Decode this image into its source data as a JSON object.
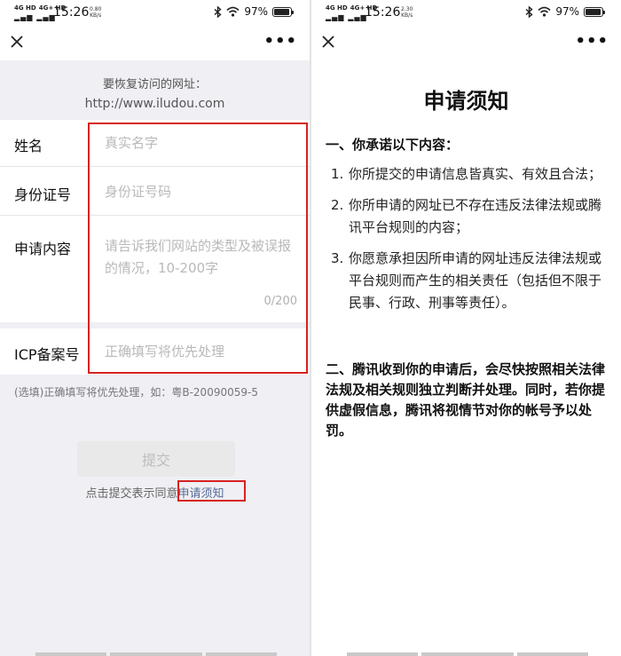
{
  "status_left": {
    "net1": "4G HD",
    "net2": "4G+ HD",
    "time": "15:26",
    "speed_value": "0.80",
    "speed_unit": "KB/s",
    "battery": "97%"
  },
  "status_right": {
    "net1": "4G HD",
    "net2": "4G+ HD",
    "time": "15:26",
    "speed_value": "2.30",
    "speed_unit": "KB/s",
    "battery": "97%"
  },
  "nav": {
    "more": "•••"
  },
  "form": {
    "url_label": "要恢复访问的网址：",
    "url": "http://www.iludou.com",
    "name_label": "姓名",
    "name_placeholder": "真实名字",
    "id_label": "身份证号",
    "id_placeholder": "身份证号码",
    "content_label": "申请内容",
    "content_placeholder": "请告诉我们网站的类型及被误报的情况，10-200字",
    "counter": "0/200",
    "icp_label": "ICP备案号",
    "icp_placeholder": "正确填写将优先处理",
    "hint": "(选填)正确填写将优先处理，如：粤B-20090059-5",
    "submit": "提交",
    "agree_prefix": "点击提交表示同意",
    "agree_link": "申请须知"
  },
  "notice": {
    "title": "申请须知",
    "section1": "一、你承诺以下内容：",
    "items": [
      {
        "num": "1.",
        "text": "你所提交的申请信息皆真实、有效且合法；"
      },
      {
        "num": "2.",
        "text": "你所申请的网址已不存在违反法律法规或腾讯平台规则的内容；"
      },
      {
        "num": "3.",
        "text": "你愿意承担因所申请的网址违反法律法规或平台规则而产生的相关责任（包括但不限于民事、行政、刑事等责任）。"
      }
    ],
    "section2": "二、腾讯收到你的申请后，会尽快按照相关法律法规及相关规则独立判断并处理。同时，若你提供虚假信息，腾讯将视情节对你的帐号予以处罚。"
  },
  "colors": {
    "highlight_box": "#d62222",
    "link": "#576b95",
    "page_bg": "#efeff4"
  },
  "icons": [
    "close-icon",
    "more-icon",
    "bluetooth-icon",
    "wifi-icon",
    "battery-icon",
    "signal-icon"
  ]
}
